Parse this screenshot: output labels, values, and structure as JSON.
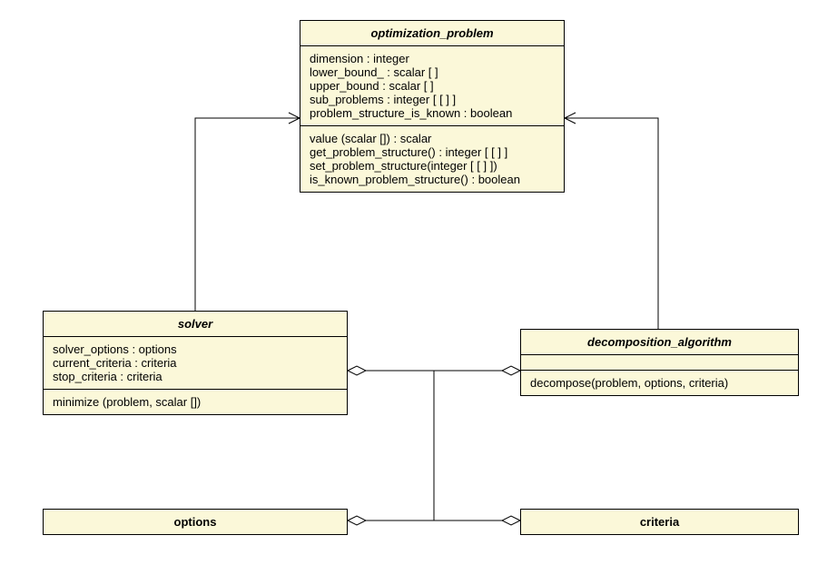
{
  "classes": {
    "optimization_problem": {
      "title": "optimization_problem",
      "attributes": [
        "dimension : integer",
        "lower_bound_ : scalar [ ]",
        "upper_bound : scalar [ ]",
        "sub_problems : integer [ [ ] ]",
        "problem_structure_is_known : boolean"
      ],
      "operations": [
        "value (scalar []) : scalar",
        "get_problem_structure() : integer [ [ ] ]",
        "set_problem_structure(integer [ [ ] ])",
        "is_known_problem_structure() : boolean"
      ]
    },
    "solver": {
      "title": "solver",
      "attributes": [
        "solver_options : options",
        "current_criteria : criteria",
        "stop_criteria : criteria"
      ],
      "operations": [
        "minimize (problem, scalar [])"
      ]
    },
    "decomposition_algorithm": {
      "title": "decomposition_algorithm",
      "attributes": [],
      "operations": [
        "decompose(problem, options, criteria)"
      ]
    },
    "options": {
      "title": "options"
    },
    "criteria": {
      "title": "criteria"
    }
  },
  "connectors": [
    {
      "from": "solver",
      "to": "optimization_problem",
      "type": "open-arrow"
    },
    {
      "from": "decomposition_algorithm",
      "to": "optimization_problem",
      "type": "open-arrow"
    },
    {
      "from": "solver",
      "to": "decomposition_algorithm",
      "type": "diamond-both"
    },
    {
      "from": "junction",
      "to": "options",
      "type": "diamond-end"
    },
    {
      "from": "junction",
      "to": "criteria",
      "type": "diamond-end"
    }
  ]
}
